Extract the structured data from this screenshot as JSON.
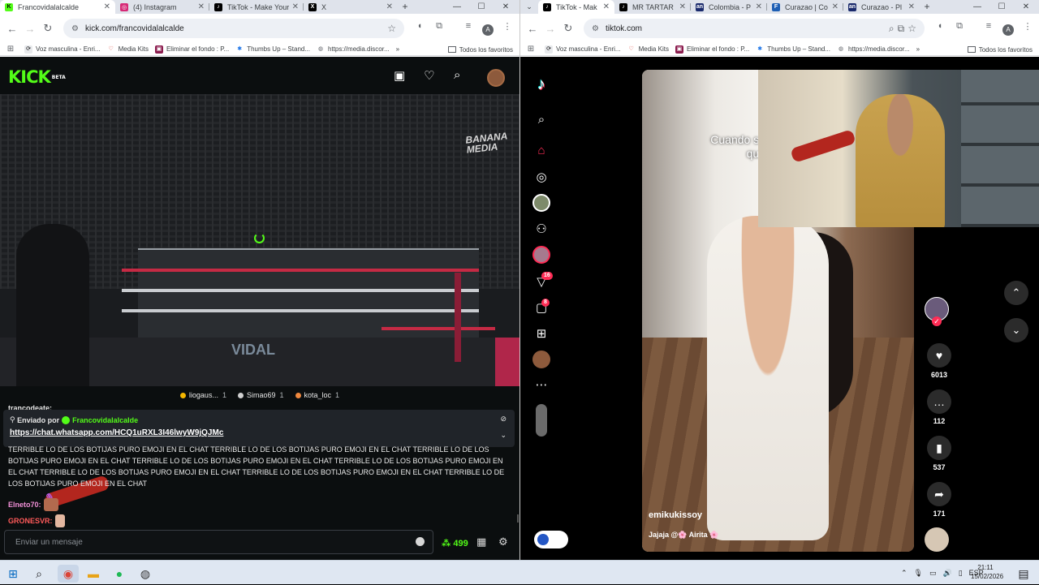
{
  "left_browser": {
    "tabs": [
      {
        "title": "Francovidalalcalde",
        "color": "#53fc18",
        "letter": "K",
        "active": true
      },
      {
        "title": "(4) Instagram",
        "color": "#d62976",
        "letter": "◎"
      },
      {
        "title": "TikTok - Make Your",
        "color": "#000000",
        "letter": "♪"
      },
      {
        "title": "X",
        "color": "#000000",
        "letter": "X"
      }
    ],
    "url": "kick.com/francovidalalcalde",
    "bookmarks": [
      "Voz masculina - Enri...",
      "Media Kits",
      "Eliminar el fondo : P...",
      "Thumbs Up – Stand...",
      "https://media.discor..."
    ],
    "all_bookmarks": "Todos los favoritos"
  },
  "right_browser": {
    "tabs": [
      {
        "title": "TikTok - Mak",
        "color": "#000000",
        "letter": "♪",
        "active": true
      },
      {
        "title": "MR TARTAR",
        "color": "#000000",
        "letter": "♪"
      },
      {
        "title": "Colombia - P",
        "color": "#1a2a6c",
        "letter": "an"
      },
      {
        "title": "Curazao | Co",
        "color": "#1e5fb4",
        "letter": "F"
      },
      {
        "title": "Curazao - Pl",
        "color": "#1a2a6c",
        "letter": "an"
      }
    ],
    "url": "tiktok.com",
    "bookmarks": [
      "Voz masculina - Enri...",
      "Media Kits",
      "Eliminar el fondo : P...",
      "Thumbs Up – Stand...",
      "https://media.discor..."
    ],
    "all_bookmarks": "Todos los favoritos"
  },
  "kick": {
    "logo": "KICK",
    "logo_tag": "BETA",
    "watermark_top": "BANANA\nMEDIA",
    "watermark_ring": "VIDAL",
    "gifters": [
      {
        "name": "liogaus...",
        "count": "1",
        "color": "#f5b700"
      },
      {
        "name": "Simao69",
        "count": "1",
        "color": "#d0d0d0"
      },
      {
        "name": "kota_loc",
        "count": "1",
        "color": "#f0883e"
      }
    ],
    "cut_user": "trancodeate:",
    "pinned": {
      "sent_by": "Enviado por",
      "user": "Francovidalalcalde",
      "link": "https://chat.whatsapp.com/HCQ1uRXL3I46lwyW9jQJMc"
    },
    "long_message": "TERRIBLE LO DE LOS BOTIJAS PURO EMOJI EN EL CHAT TERRIBLE LO DE LOS BOTIJAS PURO EMOJI EN EL CHAT TERRIBLE LO DE LOS BOTIJAS PURO EMOJI EN EL CHAT TERRIBLE LO DE LOS BOTIJAS PURO EMOJI EN EL CHAT TERRIBLE LO DE LOS BOTIJAS PURO EMOJI EN EL CHAT TERRIBLE LO DE LOS BOTIJAS PURO EMOJI EN EL CHAT TERRIBLE LO DE LOS BOTIJAS PURO EMOJI EN EL CHAT TERRIBLE LO DE LOS BOTIJAS PURO EMOJI EN EL CHAT",
    "messages": [
      {
        "user": "Elneto70:",
        "color": "#f08fd6"
      },
      {
        "user": "GRONESVR:",
        "color": "#ff5a5a"
      }
    ],
    "input_placeholder": "Enviar un mensaje",
    "points": "499"
  },
  "tiktok": {
    "caption": "Cuando sa que",
    "author": "emikukissoy",
    "description": "Jajaja @🌸 Airita 🌸",
    "likes": "6013",
    "comments": "112",
    "saves": "537",
    "shares": "171",
    "badges": {
      "activity": "16",
      "messages": "8"
    }
  },
  "taskbar": {
    "language": "ESP",
    "time": "21:11",
    "date": "15/02/2026"
  }
}
